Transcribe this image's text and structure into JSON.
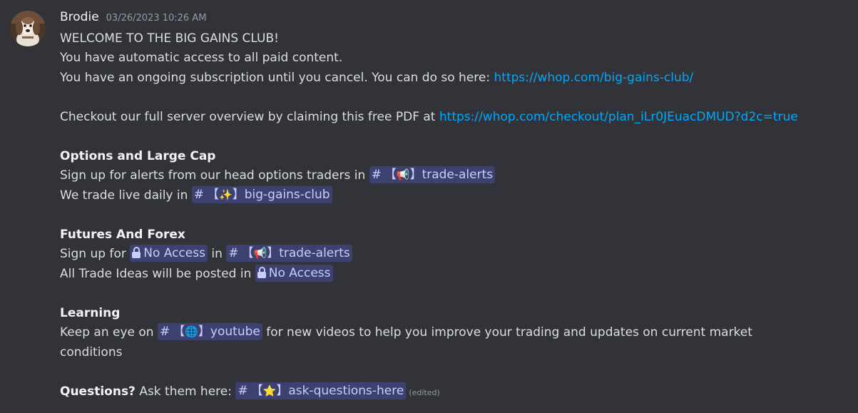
{
  "author": {
    "name": "Brodie",
    "timestamp": "03/26/2023 10:26 AM",
    "avatar_icon": "dog-avatar"
  },
  "lines": {
    "l1": "WELCOME TO THE BIG GAINS CLUB!",
    "l2": "You have automatic access to all paid content.",
    "l3": "You have an ongoing subscription until you cancel. You can do so here: ",
    "l3_link": "https://whop.com/big-gains-club/",
    "l4": "Checkout our full server overview by claiming this free PDF at ",
    "l4_link": "https://whop.com/checkout/plan_iLr0JEuacDMUD?d2c=true",
    "options_heading": "Options and Large Cap",
    "options_line1": "Sign up for alerts from our head options traders in ",
    "options_line2": "We trade live daily in ",
    "futures_heading": "Futures And Forex",
    "futures_line1_a": "Sign up for ",
    "futures_line1_b": " in ",
    "futures_line2": "All Trade Ideas will be posted in ",
    "learning_heading": "Learning",
    "learning_line1_a": "Keep an eye on ",
    "learning_line1_b": " for new videos to help you improve your trading and updates on current market",
    "learning_line2": "conditions",
    "questions_heading": "Questions?",
    "questions_text": " Ask them here: ",
    "edited": "(edited)"
  },
  "mentions": {
    "hash": "#",
    "bracket_open": "【",
    "bracket_close": "】",
    "trade_alerts": "trade-alerts",
    "trade_alerts_emoji": "📢",
    "big_gains_club": "big-gains-club",
    "big_gains_club_emoji": "✨",
    "no_access": "No Access",
    "youtube": "youtube",
    "youtube_emoji": "🌐",
    "ask_questions": "ask-questions-here",
    "ask_questions_emoji": "⭐"
  },
  "colors": {
    "background": "#313338",
    "text": "#dbdee1",
    "link": "#00a8fc",
    "mention_text": "#c9cdfb",
    "timestamp": "#949ba4"
  }
}
